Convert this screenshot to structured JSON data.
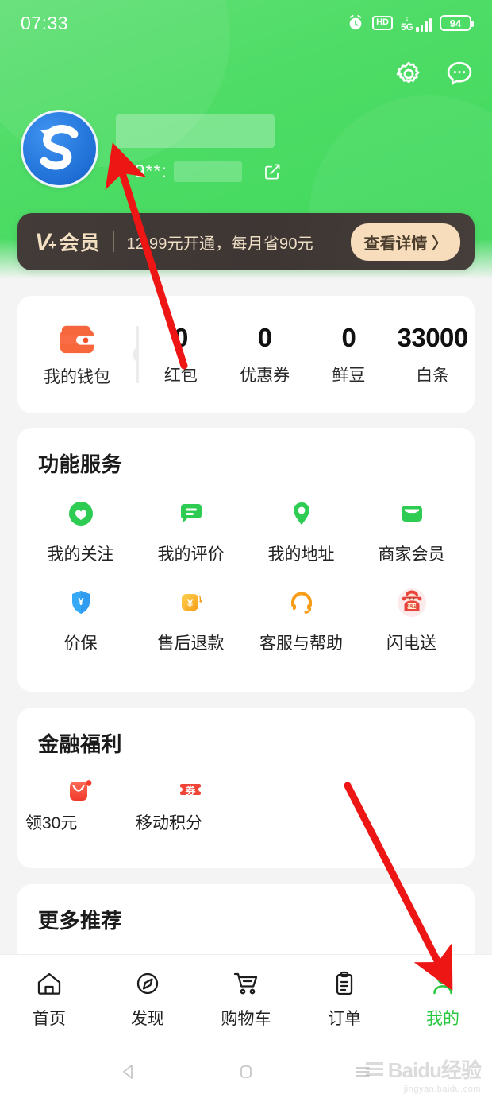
{
  "status_bar": {
    "time": "07:33",
    "hd_label": "HD",
    "network_label": "5G",
    "battery_level": "94",
    "icons": [
      "alarm-icon",
      "hd-icon",
      "signal-icon",
      "battery-icon"
    ]
  },
  "header": {
    "settings_icon": "gear-icon",
    "message_icon": "chat-bubble-icon",
    "avatar_icon": "user-avatar",
    "username_masked": "",
    "phone_masked": "1*9**:",
    "edit_icon": "edit-icon",
    "accent_green": "#4edc66"
  },
  "member_banner": {
    "brand_v": "V",
    "brand_plus": "+",
    "brand_cn": "会员",
    "description": "12.99元开通，每月省90元",
    "cta_label": "查看详情 〉",
    "bg_color": "#403936",
    "cta_color": "#f7ddbb"
  },
  "wallet_card": {
    "wallet_icon": "wallet-icon",
    "wallet_label": "我的钱包",
    "stats": [
      {
        "value": "0",
        "label": "红包"
      },
      {
        "value": "0",
        "label": "优惠券"
      },
      {
        "value": "0",
        "label": "鲜豆"
      },
      {
        "value": "33000",
        "label": "白条"
      }
    ]
  },
  "services_card": {
    "title": "功能服务",
    "items": [
      {
        "label": "我的关注",
        "icon": "heart-icon"
      },
      {
        "label": "我的评价",
        "icon": "comment-icon"
      },
      {
        "label": "我的地址",
        "icon": "location-pin-icon"
      },
      {
        "label": "商家会员",
        "icon": "membership-card-icon"
      },
      {
        "label": "价保",
        "icon": "price-shield-icon"
      },
      {
        "label": "售后退款",
        "icon": "refund-icon"
      },
      {
        "label": "客服与帮助",
        "icon": "headset-icon"
      },
      {
        "label": "闪电送",
        "icon": "flash-delivery-icon"
      }
    ]
  },
  "finance_card": {
    "title": "金融福利",
    "items": [
      {
        "label": "领30元",
        "icon": "red-envelope-icon",
        "badge": true
      },
      {
        "label": "移动积分",
        "icon": "coupon-icon",
        "badge": false
      }
    ]
  },
  "more_card": {
    "title": "更多推荐"
  },
  "bottom_nav": {
    "active_color": "#27c840",
    "items": [
      {
        "label": "首页",
        "icon": "home-icon",
        "active": false
      },
      {
        "label": "发现",
        "icon": "compass-icon",
        "active": false
      },
      {
        "label": "购物车",
        "icon": "cart-icon",
        "active": false
      },
      {
        "label": "订单",
        "icon": "clipboard-icon",
        "active": false
      },
      {
        "label": "我的",
        "icon": "person-icon",
        "active": true
      }
    ]
  },
  "android_nav": {
    "back_icon": "back-triangle-icon",
    "home_icon": "home-square-icon",
    "recents_icon": "recents-icon"
  },
  "watermark": {
    "text": "Baidu经验",
    "sub": "jingyan.baidu.com"
  },
  "annotations": {
    "arrow_color": "#ee1515",
    "arrow_1_target": "avatar",
    "arrow_2_target": "my-tab"
  }
}
